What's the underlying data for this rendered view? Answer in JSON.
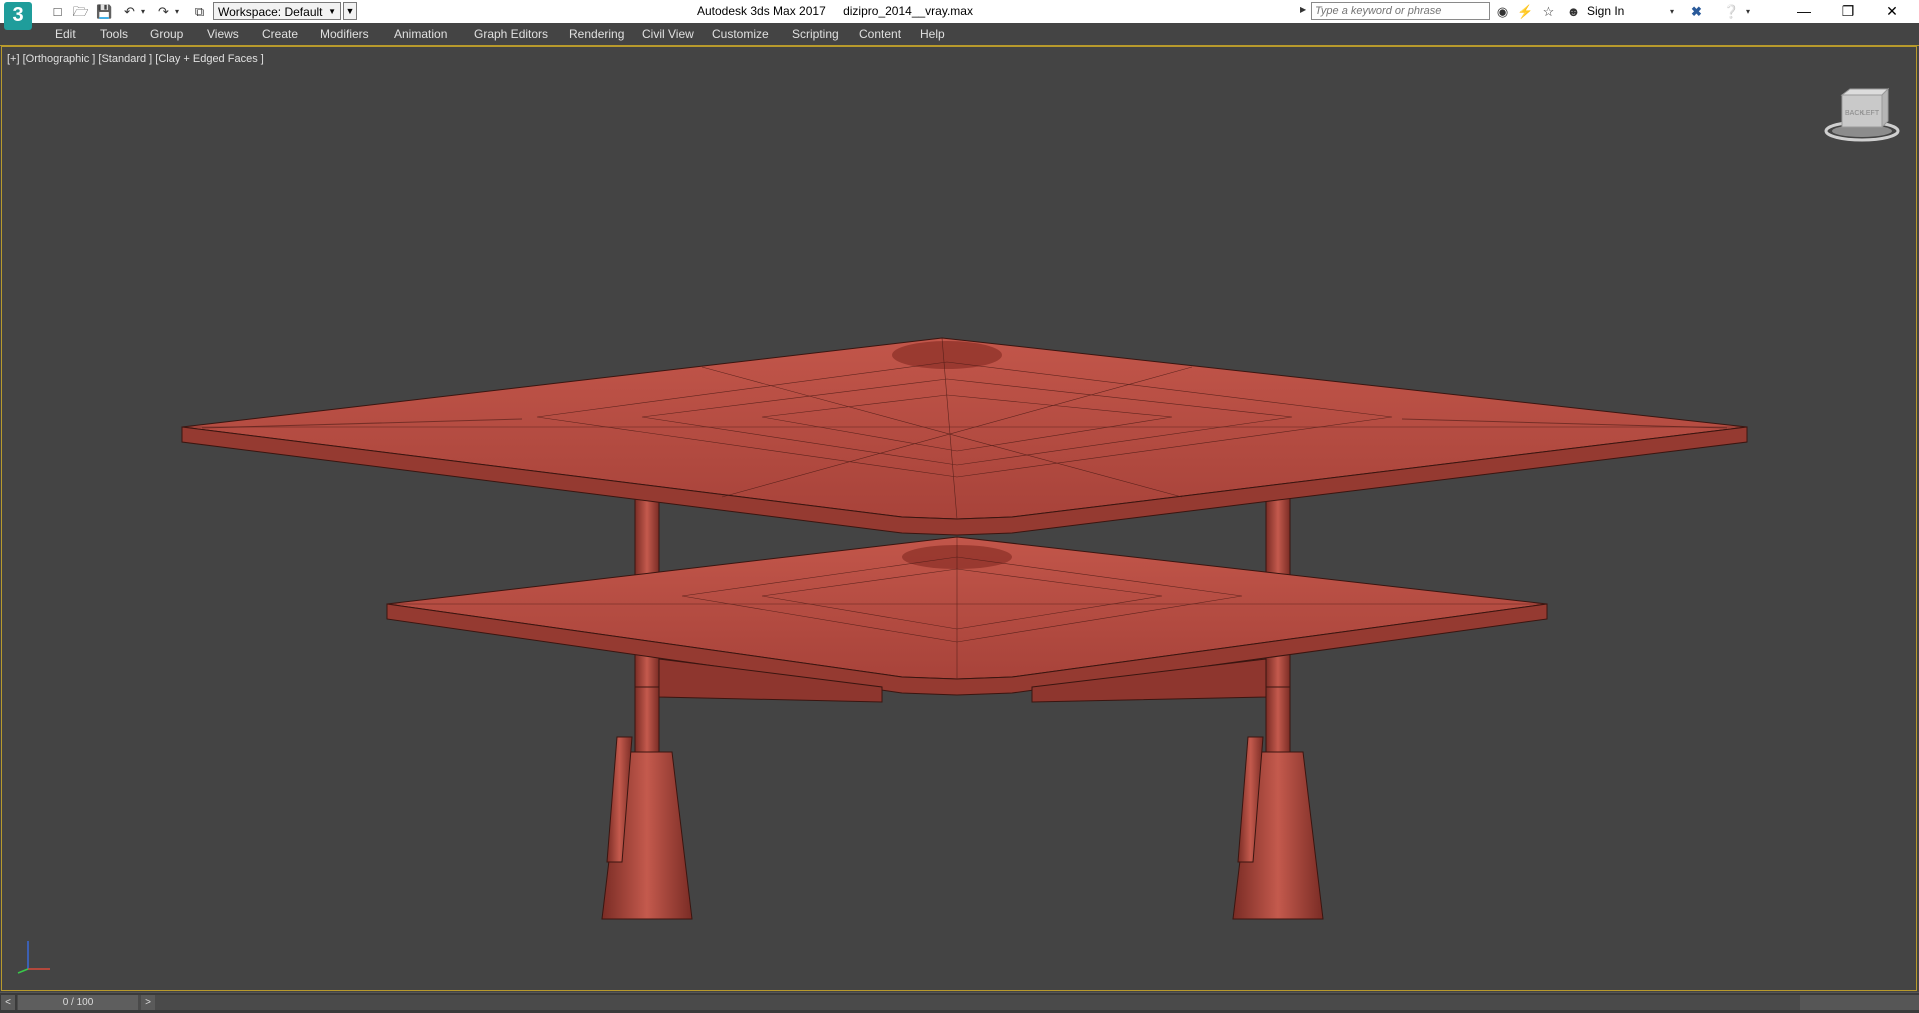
{
  "app": {
    "logo_text": "3",
    "window_title": "Autodesk 3ds Max 2017",
    "file_name": "dizipro_2014__vray.max"
  },
  "quick_access": {
    "workspace_label": "Workspace: Default"
  },
  "infocenter": {
    "search_placeholder": "Type a keyword or phrase",
    "sign_in_label": "Sign In"
  },
  "menu": {
    "items": [
      "Edit",
      "Tools",
      "Group",
      "Views",
      "Create",
      "Modifiers",
      "Animation",
      "Graph Editors",
      "Rendering",
      "Civil View",
      "Customize",
      "Scripting",
      "Content",
      "Help"
    ]
  },
  "viewport": {
    "label": "[+] [Orthographic ] [Standard ] [Clay + Edged Faces ]",
    "model_color": "#b84a3e",
    "background_color": "#444444",
    "viewcube_faces": [
      "BACK",
      "LEFT"
    ]
  },
  "timeline": {
    "frame_readout": "0 / 100",
    "prev_label": "<",
    "next_label": ">"
  },
  "colors": {
    "accent_border": "#b89a2c",
    "titlebar_bg": "#ffffff",
    "ui_dark": "#444444"
  }
}
